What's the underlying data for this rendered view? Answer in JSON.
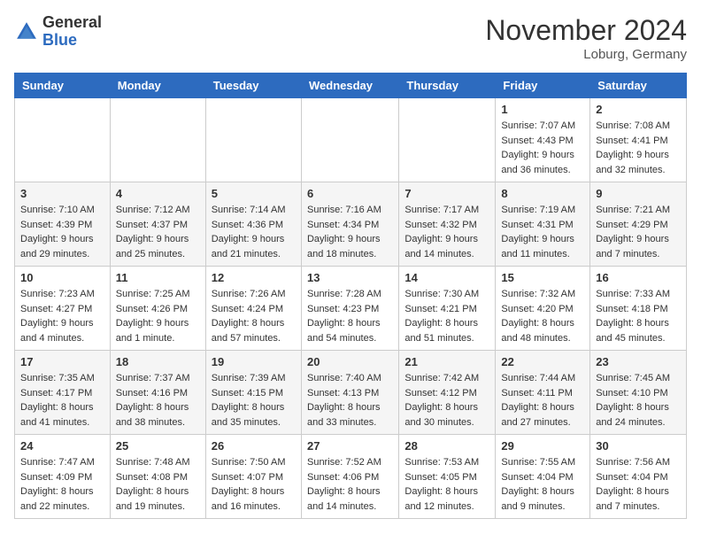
{
  "header": {
    "logo_general": "General",
    "logo_blue": "Blue",
    "month_title": "November 2024",
    "location": "Loburg, Germany"
  },
  "weekdays": [
    "Sunday",
    "Monday",
    "Tuesday",
    "Wednesday",
    "Thursday",
    "Friday",
    "Saturday"
  ],
  "weeks": [
    [
      {
        "day": "",
        "info": ""
      },
      {
        "day": "",
        "info": ""
      },
      {
        "day": "",
        "info": ""
      },
      {
        "day": "",
        "info": ""
      },
      {
        "day": "",
        "info": ""
      },
      {
        "day": "1",
        "info": "Sunrise: 7:07 AM\nSunset: 4:43 PM\nDaylight: 9 hours\nand 36 minutes."
      },
      {
        "day": "2",
        "info": "Sunrise: 7:08 AM\nSunset: 4:41 PM\nDaylight: 9 hours\nand 32 minutes."
      }
    ],
    [
      {
        "day": "3",
        "info": "Sunrise: 7:10 AM\nSunset: 4:39 PM\nDaylight: 9 hours\nand 29 minutes."
      },
      {
        "day": "4",
        "info": "Sunrise: 7:12 AM\nSunset: 4:37 PM\nDaylight: 9 hours\nand 25 minutes."
      },
      {
        "day": "5",
        "info": "Sunrise: 7:14 AM\nSunset: 4:36 PM\nDaylight: 9 hours\nand 21 minutes."
      },
      {
        "day": "6",
        "info": "Sunrise: 7:16 AM\nSunset: 4:34 PM\nDaylight: 9 hours\nand 18 minutes."
      },
      {
        "day": "7",
        "info": "Sunrise: 7:17 AM\nSunset: 4:32 PM\nDaylight: 9 hours\nand 14 minutes."
      },
      {
        "day": "8",
        "info": "Sunrise: 7:19 AM\nSunset: 4:31 PM\nDaylight: 9 hours\nand 11 minutes."
      },
      {
        "day": "9",
        "info": "Sunrise: 7:21 AM\nSunset: 4:29 PM\nDaylight: 9 hours\nand 7 minutes."
      }
    ],
    [
      {
        "day": "10",
        "info": "Sunrise: 7:23 AM\nSunset: 4:27 PM\nDaylight: 9 hours\nand 4 minutes."
      },
      {
        "day": "11",
        "info": "Sunrise: 7:25 AM\nSunset: 4:26 PM\nDaylight: 9 hours\nand 1 minute."
      },
      {
        "day": "12",
        "info": "Sunrise: 7:26 AM\nSunset: 4:24 PM\nDaylight: 8 hours\nand 57 minutes."
      },
      {
        "day": "13",
        "info": "Sunrise: 7:28 AM\nSunset: 4:23 PM\nDaylight: 8 hours\nand 54 minutes."
      },
      {
        "day": "14",
        "info": "Sunrise: 7:30 AM\nSunset: 4:21 PM\nDaylight: 8 hours\nand 51 minutes."
      },
      {
        "day": "15",
        "info": "Sunrise: 7:32 AM\nSunset: 4:20 PM\nDaylight: 8 hours\nand 48 minutes."
      },
      {
        "day": "16",
        "info": "Sunrise: 7:33 AM\nSunset: 4:18 PM\nDaylight: 8 hours\nand 45 minutes."
      }
    ],
    [
      {
        "day": "17",
        "info": "Sunrise: 7:35 AM\nSunset: 4:17 PM\nDaylight: 8 hours\nand 41 minutes."
      },
      {
        "day": "18",
        "info": "Sunrise: 7:37 AM\nSunset: 4:16 PM\nDaylight: 8 hours\nand 38 minutes."
      },
      {
        "day": "19",
        "info": "Sunrise: 7:39 AM\nSunset: 4:15 PM\nDaylight: 8 hours\nand 35 minutes."
      },
      {
        "day": "20",
        "info": "Sunrise: 7:40 AM\nSunset: 4:13 PM\nDaylight: 8 hours\nand 33 minutes."
      },
      {
        "day": "21",
        "info": "Sunrise: 7:42 AM\nSunset: 4:12 PM\nDaylight: 8 hours\nand 30 minutes."
      },
      {
        "day": "22",
        "info": "Sunrise: 7:44 AM\nSunset: 4:11 PM\nDaylight: 8 hours\nand 27 minutes."
      },
      {
        "day": "23",
        "info": "Sunrise: 7:45 AM\nSunset: 4:10 PM\nDaylight: 8 hours\nand 24 minutes."
      }
    ],
    [
      {
        "day": "24",
        "info": "Sunrise: 7:47 AM\nSunset: 4:09 PM\nDaylight: 8 hours\nand 22 minutes."
      },
      {
        "day": "25",
        "info": "Sunrise: 7:48 AM\nSunset: 4:08 PM\nDaylight: 8 hours\nand 19 minutes."
      },
      {
        "day": "26",
        "info": "Sunrise: 7:50 AM\nSunset: 4:07 PM\nDaylight: 8 hours\nand 16 minutes."
      },
      {
        "day": "27",
        "info": "Sunrise: 7:52 AM\nSunset: 4:06 PM\nDaylight: 8 hours\nand 14 minutes."
      },
      {
        "day": "28",
        "info": "Sunrise: 7:53 AM\nSunset: 4:05 PM\nDaylight: 8 hours\nand 12 minutes."
      },
      {
        "day": "29",
        "info": "Sunrise: 7:55 AM\nSunset: 4:04 PM\nDaylight: 8 hours\nand 9 minutes."
      },
      {
        "day": "30",
        "info": "Sunrise: 7:56 AM\nSunset: 4:04 PM\nDaylight: 8 hours\nand 7 minutes."
      }
    ]
  ]
}
